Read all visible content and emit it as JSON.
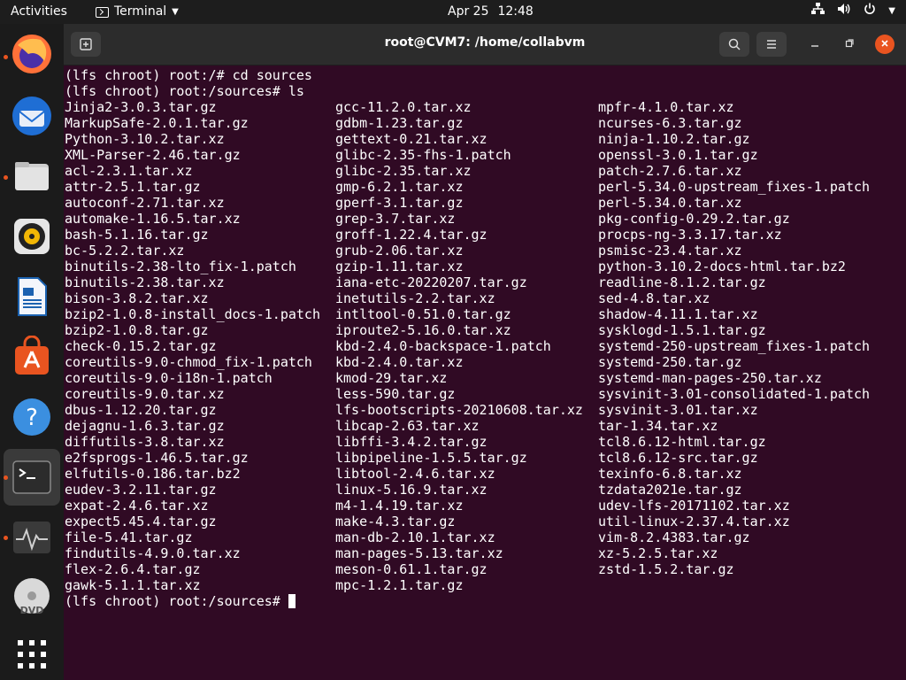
{
  "topbar": {
    "activities": "Activities",
    "app_name": "Terminal",
    "date": "Apr 25",
    "time": "12:48"
  },
  "window": {
    "title": "root@CVM7: /home/collabvm"
  },
  "dock": {
    "items": [
      "firefox-icon",
      "thunderbird-icon",
      "files-icon",
      "rhythmbox-icon",
      "libreoffice-writer-icon",
      "app-center-icon",
      "help-icon",
      "terminal-icon",
      "system-monitor-icon",
      "dvd-icon",
      "show-apps-icon"
    ]
  },
  "terminal": {
    "commands": [
      "(lfs chroot) root:/# cd sources",
      "(lfs chroot) root:/sources# ls"
    ],
    "listing": {
      "col1": [
        "Jinja2-3.0.3.tar.gz",
        "MarkupSafe-2.0.1.tar.gz",
        "Python-3.10.2.tar.xz",
        "XML-Parser-2.46.tar.gz",
        "acl-2.3.1.tar.xz",
        "attr-2.5.1.tar.gz",
        "autoconf-2.71.tar.xz",
        "automake-1.16.5.tar.xz",
        "bash-5.1.16.tar.gz",
        "bc-5.2.2.tar.xz",
        "binutils-2.38-lto_fix-1.patch",
        "binutils-2.38.tar.xz",
        "bison-3.8.2.tar.xz",
        "bzip2-1.0.8-install_docs-1.patch",
        "bzip2-1.0.8.tar.gz",
        "check-0.15.2.tar.gz",
        "coreutils-9.0-chmod_fix-1.patch",
        "coreutils-9.0-i18n-1.patch",
        "coreutils-9.0.tar.xz",
        "dbus-1.12.20.tar.gz",
        "dejagnu-1.6.3.tar.gz",
        "diffutils-3.8.tar.xz",
        "e2fsprogs-1.46.5.tar.gz",
        "elfutils-0.186.tar.bz2",
        "eudev-3.2.11.tar.gz",
        "expat-2.4.6.tar.xz",
        "expect5.45.4.tar.gz",
        "file-5.41.tar.gz",
        "findutils-4.9.0.tar.xz",
        "flex-2.6.4.tar.gz",
        "gawk-5.1.1.tar.xz"
      ],
      "col2": [
        "gcc-11.2.0.tar.xz",
        "gdbm-1.23.tar.gz",
        "gettext-0.21.tar.xz",
        "glibc-2.35-fhs-1.patch",
        "glibc-2.35.tar.xz",
        "gmp-6.2.1.tar.xz",
        "gperf-3.1.tar.gz",
        "grep-3.7.tar.xz",
        "groff-1.22.4.tar.gz",
        "grub-2.06.tar.xz",
        "gzip-1.11.tar.xz",
        "iana-etc-20220207.tar.gz",
        "inetutils-2.2.tar.xz",
        "intltool-0.51.0.tar.gz",
        "iproute2-5.16.0.tar.xz",
        "kbd-2.4.0-backspace-1.patch",
        "kbd-2.4.0.tar.xz",
        "kmod-29.tar.xz",
        "less-590.tar.gz",
        "lfs-bootscripts-20210608.tar.xz",
        "libcap-2.63.tar.xz",
        "libffi-3.4.2.tar.gz",
        "libpipeline-1.5.5.tar.gz",
        "libtool-2.4.6.tar.xz",
        "linux-5.16.9.tar.xz",
        "m4-1.4.19.tar.xz",
        "make-4.3.tar.gz",
        "man-db-2.10.1.tar.xz",
        "man-pages-5.13.tar.xz",
        "meson-0.61.1.tar.gz",
        "mpc-1.2.1.tar.gz"
      ],
      "col3": [
        "mpfr-4.1.0.tar.xz",
        "ncurses-6.3.tar.gz",
        "ninja-1.10.2.tar.gz",
        "openssl-3.0.1.tar.gz",
        "patch-2.7.6.tar.xz",
        "perl-5.34.0-upstream_fixes-1.patch",
        "perl-5.34.0.tar.xz",
        "pkg-config-0.29.2.tar.gz",
        "procps-ng-3.3.17.tar.xz",
        "psmisc-23.4.tar.xz",
        "python-3.10.2-docs-html.tar.bz2",
        "readline-8.1.2.tar.gz",
        "sed-4.8.tar.xz",
        "shadow-4.11.1.tar.xz",
        "sysklogd-1.5.1.tar.gz",
        "systemd-250-upstream_fixes-1.patch",
        "systemd-250.tar.gz",
        "systemd-man-pages-250.tar.xz",
        "sysvinit-3.01-consolidated-1.patch",
        "sysvinit-3.01.tar.xz",
        "tar-1.34.tar.xz",
        "tcl8.6.12-html.tar.gz",
        "tcl8.6.12-src.tar.gz",
        "texinfo-6.8.tar.xz",
        "tzdata2021e.tar.gz",
        "udev-lfs-20171102.tar.xz",
        "util-linux-2.37.4.tar.xz",
        "vim-8.2.4383.tar.gz",
        "xz-5.2.5.tar.xz",
        "zstd-1.5.2.tar.gz"
      ]
    },
    "prompt": "(lfs chroot) root:/sources#"
  },
  "colors": {
    "terminal_bg": "#300a24",
    "accent": "#e95420",
    "topbar_bg": "#1d1d1d"
  }
}
